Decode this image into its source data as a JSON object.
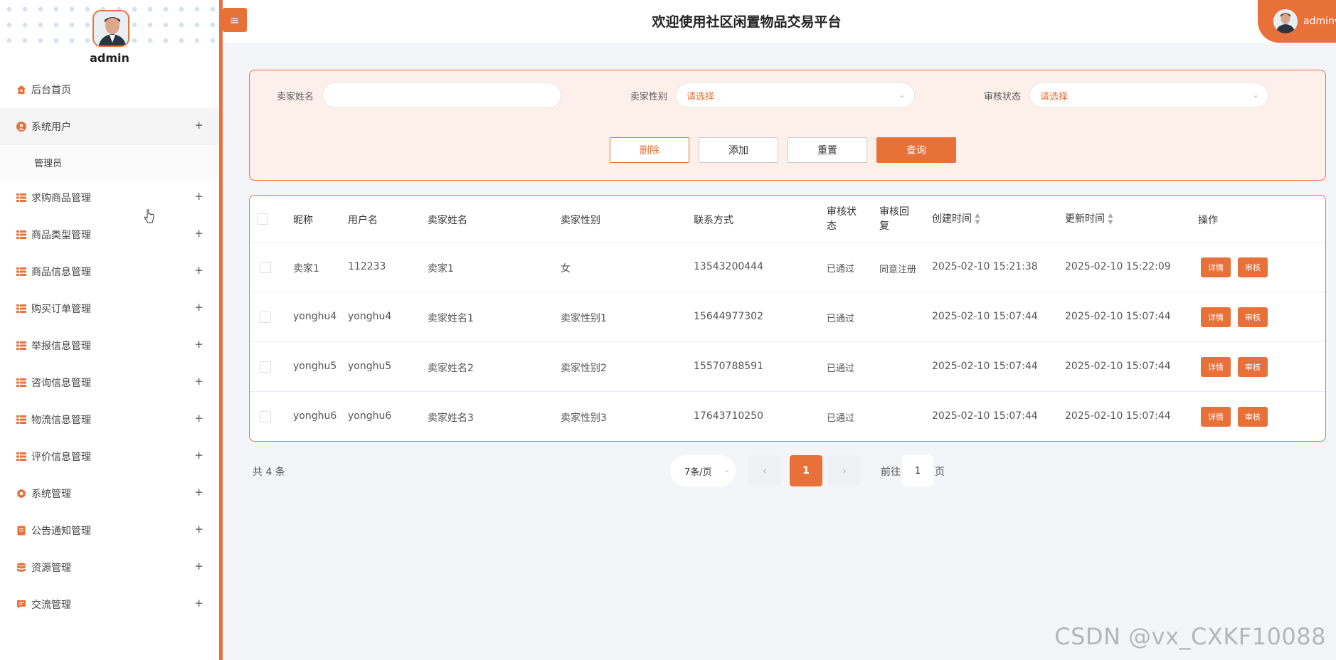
{
  "sidebar": {
    "username": "admin",
    "items": [
      {
        "label": "后台首页",
        "icon": "home-icon",
        "expandable": false
      },
      {
        "label": "系统用户",
        "icon": "user-circle-icon",
        "expandable": true,
        "plus": "+",
        "children": [
          "管理员"
        ]
      },
      {
        "label": "求购商品管理",
        "icon": "grid-icon",
        "expandable": true,
        "plus": "+"
      },
      {
        "label": "商品类型管理",
        "icon": "grid-icon",
        "expandable": true,
        "plus": "+"
      },
      {
        "label": "商品信息管理",
        "icon": "grid-icon",
        "expandable": true,
        "plus": "+"
      },
      {
        "label": "购买订单管理",
        "icon": "grid-icon",
        "expandable": true,
        "plus": "+"
      },
      {
        "label": "举报信息管理",
        "icon": "grid-icon",
        "expandable": true,
        "plus": "+"
      },
      {
        "label": "咨询信息管理",
        "icon": "grid-icon",
        "expandable": true,
        "plus": "+"
      },
      {
        "label": "物流信息管理",
        "icon": "grid-icon",
        "expandable": true,
        "plus": "+"
      },
      {
        "label": "评价信息管理",
        "icon": "grid-icon",
        "expandable": true,
        "plus": "+"
      },
      {
        "label": "系统管理",
        "icon": "settings-icon",
        "expandable": true,
        "plus": "+"
      },
      {
        "label": "公告通知管理",
        "icon": "notice-icon",
        "expandable": true,
        "plus": "+"
      },
      {
        "label": "资源管理",
        "icon": "database-icon",
        "expandable": true,
        "plus": "+"
      },
      {
        "label": "交流管理",
        "icon": "chat-icon",
        "expandable": true,
        "plus": "+"
      }
    ]
  },
  "header": {
    "menu_glyph": "≡",
    "title": "欢迎使用社区闲置物品交易平台",
    "user_label": "admin▾"
  },
  "search": {
    "seller_name_label": "卖家姓名",
    "seller_name_value": "",
    "seller_gender_label": "卖家性别",
    "seller_gender_placeholder": "请选择",
    "review_status_label": "审核状态",
    "review_status_placeholder": "请选择",
    "delete_label": "删除",
    "add_label": "添加",
    "reset_label": "重置",
    "query_label": "查询"
  },
  "table": {
    "columns": [
      "昵称",
      "用户名",
      "卖家姓名",
      "卖家性别",
      "联系方式",
      "审核状态",
      "审核回复",
      "创建时间",
      "更新时间",
      "操作"
    ],
    "sortable_glyph": "▲▼",
    "rows": [
      {
        "nickname": "卖家1",
        "username": "112233",
        "seller_name": "卖家1",
        "gender": "女",
        "phone": "13543200444",
        "status": "已通过",
        "reply": "同意注册",
        "created": "2025-02-10 15:21:38",
        "updated": "2025-02-10 15:22:09",
        "detail": "详情",
        "review": "审核"
      },
      {
        "nickname": "yonghu4",
        "username": "yonghu4",
        "seller_name": "卖家姓名1",
        "gender": "卖家性别1",
        "phone": "15644977302",
        "status": "已通过",
        "reply": "",
        "created": "2025-02-10 15:07:44",
        "updated": "2025-02-10 15:07:44",
        "detail": "详情",
        "review": "审核"
      },
      {
        "nickname": "yonghu5",
        "username": "yonghu5",
        "seller_name": "卖家姓名2",
        "gender": "卖家性别2",
        "phone": "15570788591",
        "status": "已通过",
        "reply": "",
        "created": "2025-02-10 15:07:44",
        "updated": "2025-02-10 15:07:44",
        "detail": "详情",
        "review": "审核"
      },
      {
        "nickname": "yonghu6",
        "username": "yonghu6",
        "seller_name": "卖家姓名3",
        "gender": "卖家性别3",
        "phone": "17643710250",
        "status": "已通过",
        "reply": "",
        "created": "2025-02-10 15:07:44",
        "updated": "2025-02-10 15:07:44",
        "detail": "详情",
        "review": "审核"
      }
    ]
  },
  "pagination": {
    "total": "共 4 条",
    "page_size": "7条/页",
    "prev": "‹",
    "current": "1",
    "next": "›",
    "goto_prefix": "前往",
    "goto_value": "1",
    "goto_suffix": "页"
  },
  "watermark": "CSDN @vx_CXKF10088",
  "colors": {
    "accent": "#e8713a",
    "panel_bg": "#fdf0ea",
    "page_bg": "#f4f5f9"
  }
}
